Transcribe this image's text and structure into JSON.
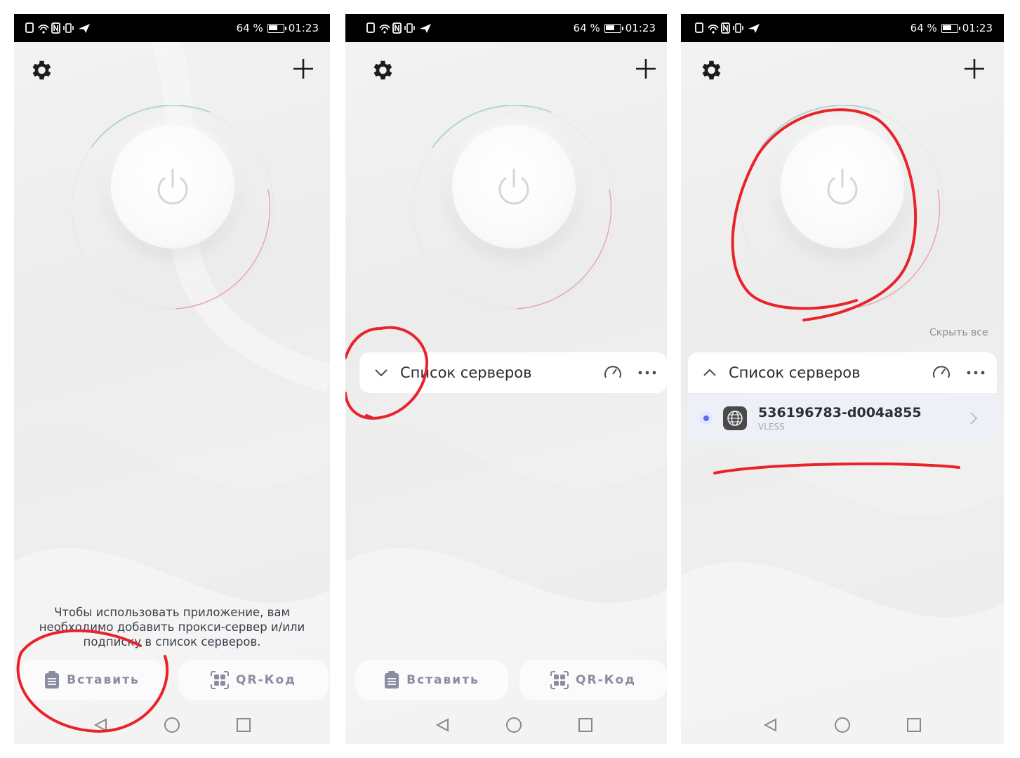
{
  "status_bar": {
    "battery": "64 %",
    "time": "01:23"
  },
  "panel1": {
    "hint": "Чтобы использовать приложение, вам необходимо добавить прокси-сервер и/или подписку в список серверов.",
    "paste_label": "Вставить",
    "qr_label": "QR-Код"
  },
  "panel2": {
    "server_list_title": "Список серверов",
    "paste_label": "Вставить",
    "qr_label": "QR-Код"
  },
  "panel3": {
    "hide_all": "Скрыть все",
    "server_list_title": "Список серверов",
    "server": {
      "name": "536196783-d004a855",
      "protocol": "VLESS"
    }
  },
  "colors": {
    "annotation": "#e8232b",
    "accent": "#5b6ef0",
    "icon": "#8c8ca1"
  }
}
